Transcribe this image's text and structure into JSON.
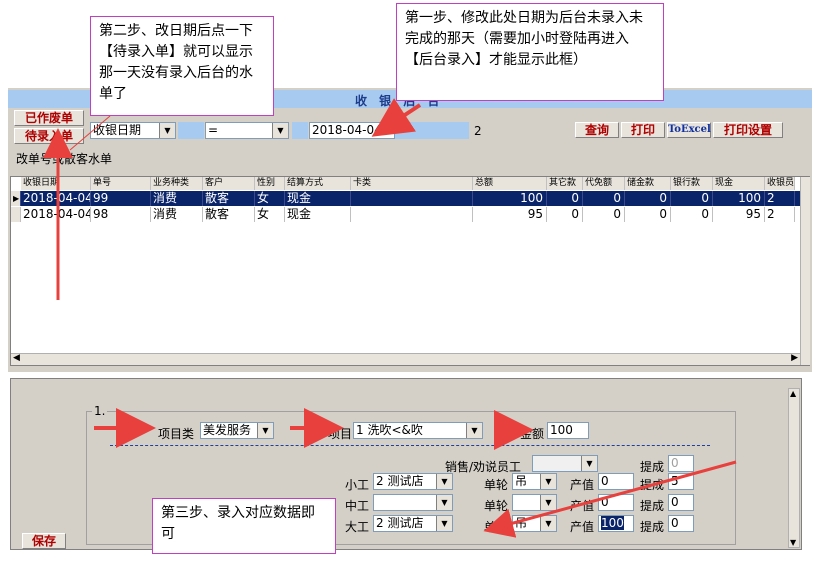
{
  "window": {
    "title": "收 银 后 台",
    "buttons": {
      "voided_bills": "已作废单",
      "pending_bills": "待录入单",
      "query": "查询",
      "print": "打印",
      "to_excel": "ToExcel",
      "print_settings": "打印设置",
      "save": "保存"
    },
    "filter": {
      "field_value": "收银日期",
      "operator": "=",
      "date_value": "2018-04-04",
      "count": "2",
      "hint": "改单号或散客水单"
    }
  },
  "grid": {
    "columns": [
      "收银日期",
      "单号",
      "业务种类",
      "客户",
      "性别",
      "结算方式",
      "卡类",
      "总额",
      "其它款",
      "代免额",
      "储金款",
      "银行款",
      "现金",
      "收银员"
    ],
    "rows": [
      {
        "date": "2018-04-04",
        "no": "99",
        "type": "消费",
        "customer": "散客",
        "gender": "女",
        "pay": "现金",
        "card": "",
        "total": "100",
        "other": "0",
        "free": "0",
        "deposit": "0",
        "bank": "0",
        "cash": "100",
        "cashier": "2"
      },
      {
        "date": "2018-04-04",
        "no": "98",
        "type": "消费",
        "customer": "散客",
        "gender": "女",
        "pay": "现金",
        "card": "",
        "total": "95",
        "other": "0",
        "free": "0",
        "deposit": "0",
        "bank": "0",
        "cash": "95",
        "cashier": "2"
      }
    ]
  },
  "entry": {
    "section": "1.",
    "category_label": "项目类",
    "category_value": "美发服务",
    "item_label": "项目",
    "item_value": "1     洗吹<&吹",
    "amount_label": "金额",
    "amount_value": "100",
    "sales_label": "销售/劝说员工",
    "commission_label": "提成",
    "commission_value": "0",
    "workers": [
      {
        "role": "小工",
        "staff": "2    测试店",
        "round_label": "单轮",
        "round": "吊",
        "output_label": "产值",
        "output": "0",
        "comm_label": "提成",
        "comm": "5"
      },
      {
        "role": "中工",
        "staff": "",
        "round_label": "单轮",
        "round": "",
        "output_label": "产值",
        "output": "0",
        "comm_label": "提成",
        "comm": "0"
      },
      {
        "role": "大工",
        "staff": "2    测试店",
        "round_label": "单轮",
        "round": "吊",
        "output_label": "产值",
        "output": "100",
        "comm_label": "提成",
        "comm": "0"
      }
    ]
  },
  "callouts": {
    "step1": "第一步、修改此处日期为后台未录入未完成的那天（需要加小时登陆再进入【后台录入】才能显示此框）",
    "step2": "第二步、改日期后点一下【待录入单】就可以显示那一天没有录入后台的水单了",
    "step3": "第三步、录入对应数据即可"
  },
  "colors": {
    "arrow": "#e8403c",
    "callout_border": "#c040c0",
    "title_bg": "#a6caf0",
    "selected_row": "#0a246a"
  }
}
